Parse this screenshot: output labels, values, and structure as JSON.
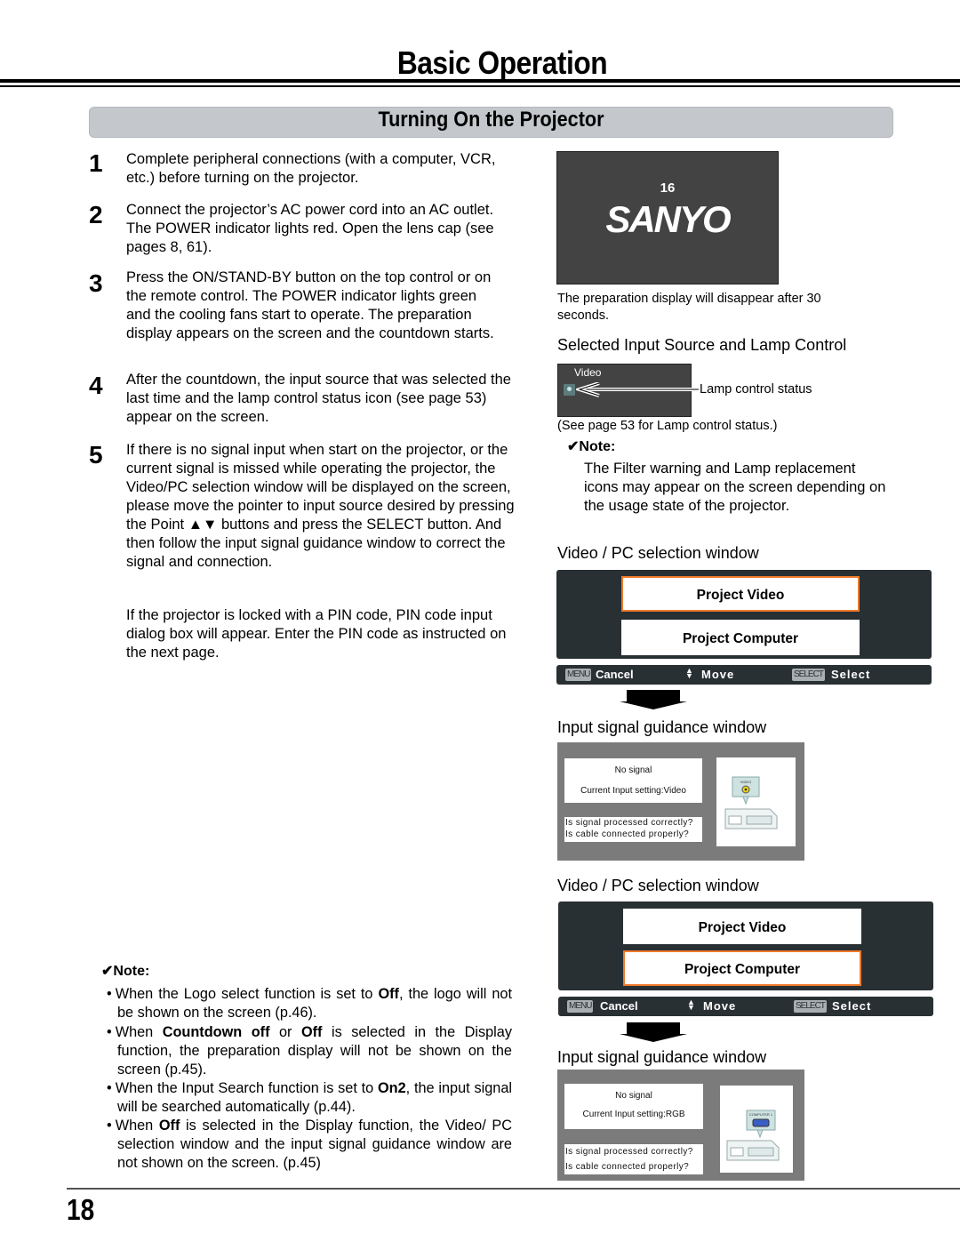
{
  "header": {
    "title": "Basic Operation",
    "section_title": "Turning On the Projector"
  },
  "steps": [
    {
      "num": "1",
      "text": "Complete peripheral connections (with a computer, VCR, etc.) before turning on the projector."
    },
    {
      "num": "2",
      "text": "Connect the projector’s AC power cord into an AC outlet. The POWER indicator lights red. Open the lens cap (see pages 8, 61)."
    },
    {
      "num": "3",
      "text": "Press the ON/STAND-BY button on the top control or on the remote control. The POWER indicator lights green and the cooling fans start to operate. The preparation display appears on the screen and the countdown starts."
    },
    {
      "num": "4",
      "text": "After the countdown, the input source that was selected the last time and the lamp control status icon (see page 53) appear on the screen."
    },
    {
      "num": "5",
      "text": "If there is no signal input when start on the projector, or the current signal is missed while operating the projector, the Video/PC selection window will be displayed on the screen, please move the pointer to input source desired by pressing the Point ▲▼ buttons and press the SELECT button. And then follow the input signal guidance window to correct the signal and connection."
    }
  ],
  "pin_note": "If the projector is locked with a PIN code, PIN code input dialog box will appear. Enter the PIN code as instructed on the next page.",
  "left_note": {
    "heading": "✔Note:",
    "bullets": [
      {
        "pre": "When the Logo select function is set to ",
        "b1": "Off",
        "mid": ", the logo will not be shown on the screen (p.46).",
        "b2": "",
        "post": ""
      },
      {
        "pre": "When ",
        "b1": "Countdown off",
        "mid": " or ",
        "b2": "Off",
        "post": " is selected in the Display function, the preparation display will not be shown on the screen (p.45)."
      },
      {
        "pre": "When the Input Search function is set to ",
        "b1": "On2",
        "mid": ", the input signal will be searched automatically (p.44).",
        "b2": "",
        "post": ""
      },
      {
        "pre": "When ",
        "b1": "Off",
        "mid": " is selected in the Display function, the Video/ PC selection window and the input signal guidance window are not shown on the screen. (p.45)",
        "b2": "",
        "post": ""
      }
    ]
  },
  "prep_display": {
    "countdown": "16",
    "logo": "SANYO",
    "caption": "The preparation display will disappear after 30 seconds."
  },
  "input_source": {
    "heading": "Selected Input Source and Lamp Control",
    "screen_label": "Video",
    "lamp_label": "Lamp control status",
    "caption": "(See page 53 for Lamp control status.)"
  },
  "right_note": {
    "heading": "✔Note:",
    "text": "The Filter warning and Lamp replacement icons may appear on the screen depending on the usage state of the projector."
  },
  "selection_windows": [
    {
      "heading": "Video / PC selection window",
      "options": [
        "Project Video",
        "Project Computer"
      ],
      "selected": 0,
      "footer": {
        "menu_key": "MENU",
        "cancel": "Cancel",
        "move": "Move",
        "select_key": "SELECT",
        "select": "Select"
      }
    },
    {
      "heading": "Video / PC selection window",
      "options": [
        "Project Video",
        "Project Computer"
      ],
      "selected": 1,
      "footer": {
        "menu_key": "MENU",
        "cancel": "Cancel",
        "move": "Move",
        "select_key": "SELECT",
        "select": "Select"
      }
    }
  ],
  "guidance_windows": [
    {
      "heading": "Input signal guidance window",
      "status": "No signal",
      "current": "Current Input setting:Video",
      "q1": "Is signal processed correctly?",
      "q2": "Is cable connected properly?",
      "port_label": "VIDEO",
      "port_color": "#e4d21c"
    },
    {
      "heading": "Input signal guidance window",
      "status": "No signal",
      "current": "Current Input setting:RGB",
      "q1": "Is signal processed correctly?",
      "q2": "Is cable connected properly?",
      "port_label": "COMPUTER 1",
      "port_color": "#3a5fc4"
    }
  ],
  "colors": {
    "osd_bg": "#293034",
    "osd_highlight": "#ee7a2a",
    "section_bar": "#c4c8cd",
    "guide_bg": "#7b7b7b"
  },
  "footer": {
    "page_number": "18"
  }
}
